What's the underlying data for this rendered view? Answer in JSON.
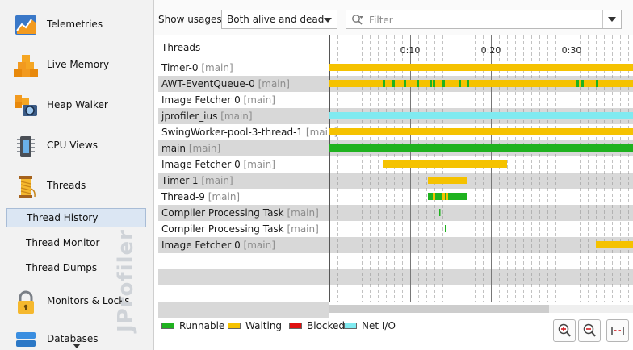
{
  "sidebar": {
    "items": [
      {
        "label": "Telemetries",
        "icon": "telemetries-icon"
      },
      {
        "label": "Live Memory",
        "icon": "live-memory-icon"
      },
      {
        "label": "Heap Walker",
        "icon": "heap-walker-icon"
      },
      {
        "label": "CPU Views",
        "icon": "cpu-views-icon"
      },
      {
        "label": "Threads",
        "icon": "threads-icon"
      },
      {
        "label": "Monitors & Locks",
        "icon": "lock-icon"
      },
      {
        "label": "Databases",
        "icon": "databases-icon"
      }
    ],
    "sub_items": [
      {
        "label": "Thread History",
        "selected": true
      },
      {
        "label": "Thread Monitor",
        "selected": false
      },
      {
        "label": "Thread Dumps",
        "selected": false
      }
    ],
    "watermark": "JProfiler"
  },
  "toolbar": {
    "usage_label": "Show usages:",
    "usage_value": "Both alive and dead",
    "filter_placeholder": "Filter"
  },
  "table": {
    "header": "Threads",
    "time_ticks": [
      "0:10",
      "0:20",
      "0:30"
    ],
    "rows": [
      {
        "name": "Timer-0",
        "group": "[main]"
      },
      {
        "name": "AWT-EventQueue-0",
        "group": "[main]"
      },
      {
        "name": "Image Fetcher 0",
        "group": "[main]"
      },
      {
        "name": "jprofiler_ius",
        "group": "[main]"
      },
      {
        "name": "SwingWorker-pool-3-thread-1",
        "group": "[main]"
      },
      {
        "name": "main",
        "group": "[main]"
      },
      {
        "name": "Image Fetcher 0",
        "group": "[main]"
      },
      {
        "name": "Timer-1",
        "group": "[main]"
      },
      {
        "name": "Thread-9",
        "group": "[main]"
      },
      {
        "name": "Compiler Processing Task",
        "group": "[main]"
      },
      {
        "name": "Compiler Processing Task",
        "group": "[main]"
      },
      {
        "name": "Image Fetcher 0",
        "group": "[main]"
      }
    ]
  },
  "legend": [
    {
      "label": "Runnable",
      "color": "#1fb21f"
    },
    {
      "label": "Waiting",
      "color": "#f5c200"
    },
    {
      "label": "Blocked",
      "color": "#e01010"
    },
    {
      "label": "Net I/O",
      "color": "#80eaf0"
    }
  ],
  "zoom_buttons": [
    "zoom-in-icon",
    "zoom-out-icon",
    "fit-width-icon"
  ]
}
